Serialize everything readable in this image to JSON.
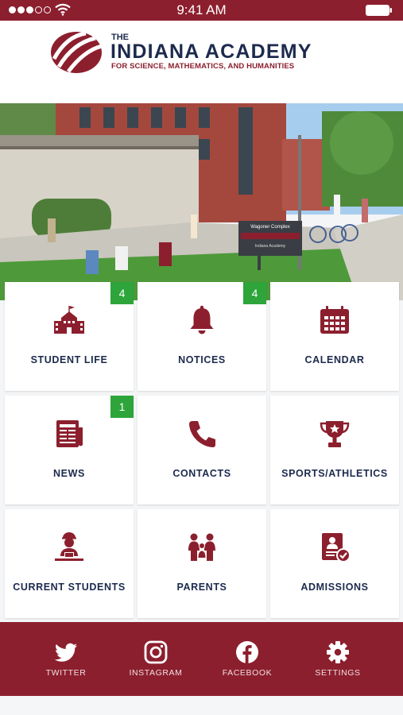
{
  "status_bar": {
    "time": "9:41 AM"
  },
  "header": {
    "logo_the": "THE",
    "logo_name": "INDIANA ACADEMY",
    "logo_subtitle": "FOR SCIENCE, MATHEMATICS, AND HUMANITIES"
  },
  "hero": {
    "sign_line1": "Wagoner Complex",
    "sign_line2": "Indiana Academy"
  },
  "tiles": [
    {
      "label": "STUDENT LIFE",
      "badge": "4",
      "icon": "school-icon"
    },
    {
      "label": "NOTICES",
      "badge": "4",
      "icon": "bell-icon"
    },
    {
      "label": "CALENDAR",
      "badge": "",
      "icon": "calendar-icon"
    },
    {
      "label": "NEWS",
      "badge": "1",
      "icon": "newspaper-icon"
    },
    {
      "label": "CONTACTS",
      "badge": "",
      "icon": "phone-icon"
    },
    {
      "label": "SPORTS/ATHLETICS",
      "badge": "",
      "icon": "trophy-icon"
    },
    {
      "label": "CURRENT STUDENTS",
      "badge": "",
      "icon": "student-icon"
    },
    {
      "label": "PARENTS",
      "badge": "",
      "icon": "family-icon"
    },
    {
      "label": "ADMISSIONS",
      "badge": "",
      "icon": "admissions-icon"
    }
  ],
  "social": [
    {
      "label": "TWITTER",
      "icon": "twitter-icon"
    },
    {
      "label": "INSTAGRAM",
      "icon": "instagram-icon"
    },
    {
      "label": "FACEBOOK",
      "icon": "facebook-icon"
    },
    {
      "label": "SETTINGS",
      "icon": "gear-icon"
    }
  ],
  "colors": {
    "brand": "#8c1f2e",
    "navy": "#1c2a4d",
    "badge": "#2da53a"
  }
}
